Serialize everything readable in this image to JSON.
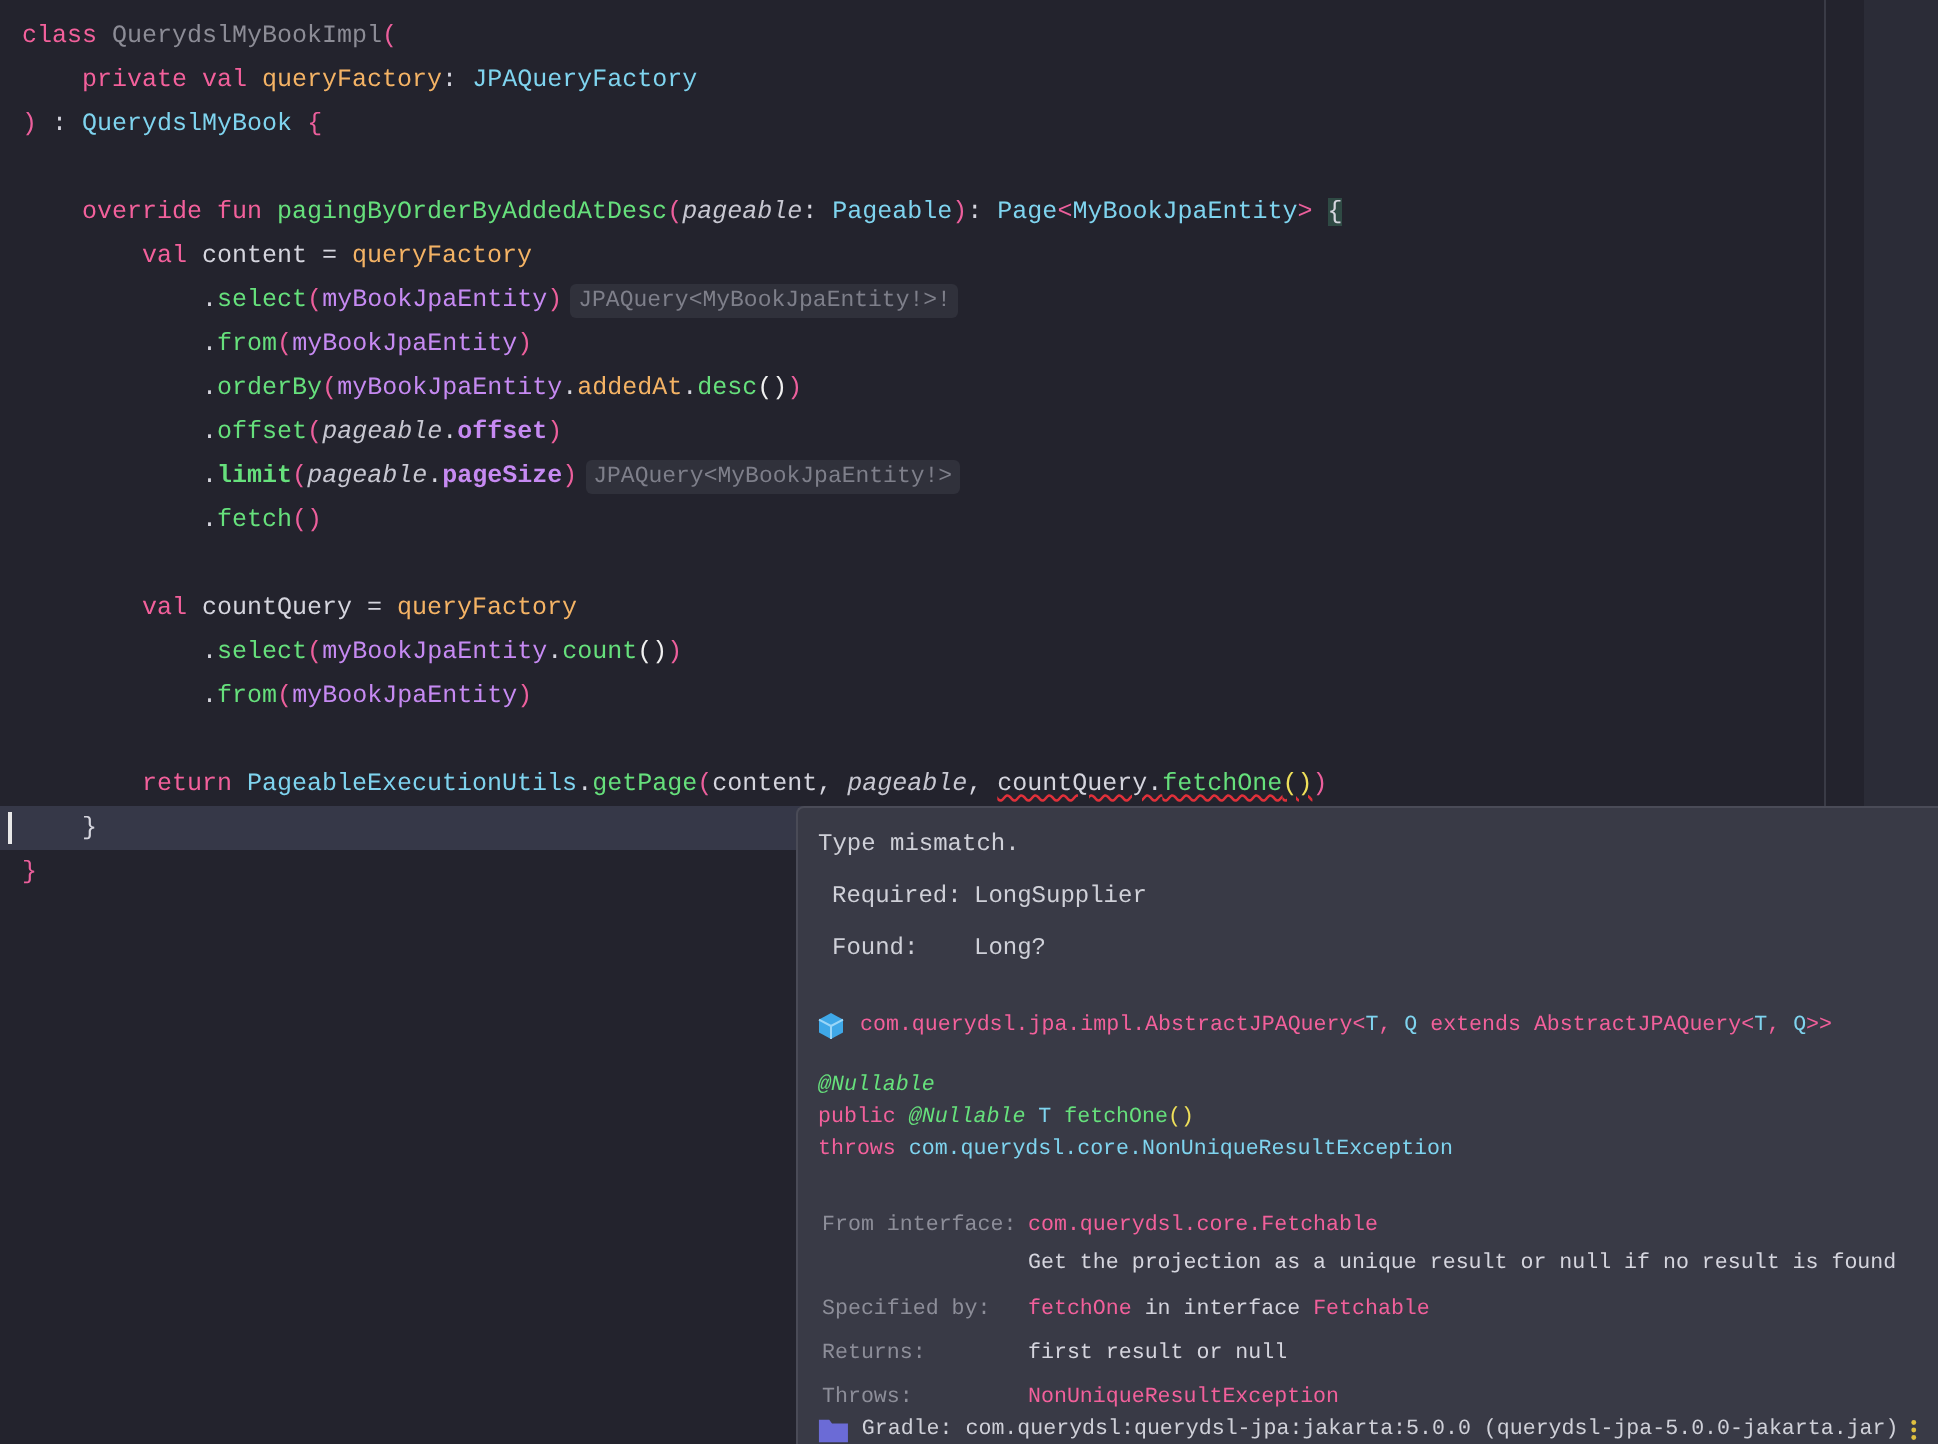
{
  "editor": {
    "lines": [
      {
        "current": false,
        "tokens": [
          {
            "kind": "kw",
            "text": "class "
          },
          {
            "kind": "unused",
            "text": "QuerydslMyBookImpl"
          },
          {
            "kind": "paren",
            "text": "("
          }
        ]
      },
      {
        "current": false,
        "tokens": [
          {
            "kind": "kw",
            "text": "    private val "
          },
          {
            "kind": "prop",
            "text": "queryFactory"
          },
          {
            "kind": "plain",
            "text": ": "
          },
          {
            "kind": "type",
            "text": "JPAQueryFactory"
          }
        ]
      },
      {
        "current": false,
        "tokens": [
          {
            "kind": "paren",
            "text": ")"
          },
          {
            "kind": "plain",
            "text": " : "
          },
          {
            "kind": "type",
            "text": "QuerydslMyBook"
          },
          {
            "kind": "paren",
            "text": " {"
          }
        ]
      },
      {
        "current": false
      },
      {
        "current": false,
        "tokens": [
          {
            "kind": "kw",
            "text": "    override fun "
          },
          {
            "kind": "func",
            "text": "pagingByOrderByAddedAtDesc"
          },
          {
            "kind": "paren",
            "text": "("
          },
          {
            "kind": "param",
            "text": "pageable"
          },
          {
            "kind": "plain",
            "text": ": "
          },
          {
            "kind": "type",
            "text": "Pageable"
          },
          {
            "kind": "paren",
            "text": ")"
          },
          {
            "kind": "plain",
            "text": ": "
          },
          {
            "kind": "type",
            "text": "Page"
          },
          {
            "kind": "paren",
            "text": "<"
          },
          {
            "kind": "type",
            "text": "MyBookJpaEntity"
          },
          {
            "kind": "paren",
            "text": "> "
          },
          {
            "kind": "brace_match",
            "text": "{"
          }
        ]
      },
      {
        "current": false,
        "tokens": [
          {
            "kind": "kw",
            "text": "        val "
          },
          {
            "kind": "plain",
            "text": "content = "
          },
          {
            "kind": "prop",
            "text": "queryFactory"
          }
        ]
      },
      {
        "current": false,
        "hint": "JPAQuery<MyBookJpaEntity!>!",
        "tokens": [
          {
            "kind": "plain",
            "text": "            ."
          },
          {
            "kind": "func",
            "text": "select"
          },
          {
            "kind": "paren",
            "text": "("
          },
          {
            "kind": "member",
            "text": "myBookJpaEntity"
          },
          {
            "kind": "paren",
            "text": ")"
          }
        ]
      },
      {
        "current": false,
        "tokens": [
          {
            "kind": "plain",
            "text": "            ."
          },
          {
            "kind": "func",
            "text": "from"
          },
          {
            "kind": "paren",
            "text": "("
          },
          {
            "kind": "member",
            "text": "myBookJpaEntity"
          },
          {
            "kind": "paren",
            "text": ")"
          }
        ]
      },
      {
        "current": false,
        "tokens": [
          {
            "kind": "plain",
            "text": "            ."
          },
          {
            "kind": "func",
            "text": "orderBy"
          },
          {
            "kind": "paren",
            "text": "("
          },
          {
            "kind": "member",
            "text": "myBookJpaEntity"
          },
          {
            "kind": "plain",
            "text": "."
          },
          {
            "kind": "prop",
            "text": "addedAt"
          },
          {
            "kind": "plain",
            "text": "."
          },
          {
            "kind": "func",
            "text": "desc"
          },
          {
            "kind": "inner_paren",
            "text": "()"
          },
          {
            "kind": "paren",
            "text": ")"
          }
        ]
      },
      {
        "current": false,
        "tokens": [
          {
            "kind": "plain",
            "text": "            ."
          },
          {
            "kind": "func",
            "text": "offset"
          },
          {
            "kind": "paren",
            "text": "("
          },
          {
            "kind": "param",
            "text": "pageable"
          },
          {
            "kind": "plain",
            "text": "."
          },
          {
            "kind": "member_bold",
            "text": "offset"
          },
          {
            "kind": "paren",
            "text": ")"
          }
        ]
      },
      {
        "current": false,
        "hint": "JPAQuery<MyBookJpaEntity!>",
        "tokens": [
          {
            "kind": "plain",
            "text": "            ."
          },
          {
            "kind": "func_bold",
            "text": "limit"
          },
          {
            "kind": "paren",
            "text": "("
          },
          {
            "kind": "param",
            "text": "pageable"
          },
          {
            "kind": "plain",
            "text": "."
          },
          {
            "kind": "member_bold",
            "text": "pageSize"
          },
          {
            "kind": "paren",
            "text": ")"
          }
        ]
      },
      {
        "current": false,
        "tokens": [
          {
            "kind": "plain",
            "text": "            ."
          },
          {
            "kind": "func",
            "text": "fetch"
          },
          {
            "kind": "paren",
            "text": "()"
          }
        ]
      },
      {
        "current": false
      },
      {
        "current": false,
        "tokens": [
          {
            "kind": "kw",
            "text": "        val "
          },
          {
            "kind": "plain",
            "text": "countQuery = "
          },
          {
            "kind": "prop",
            "text": "queryFactory"
          }
        ]
      },
      {
        "current": false,
        "tokens": [
          {
            "kind": "plain",
            "text": "            ."
          },
          {
            "kind": "func",
            "text": "select"
          },
          {
            "kind": "paren",
            "text": "("
          },
          {
            "kind": "member",
            "text": "myBookJpaEntity"
          },
          {
            "kind": "plain",
            "text": "."
          },
          {
            "kind": "func",
            "text": "count"
          },
          {
            "kind": "inner_paren",
            "text": "()"
          },
          {
            "kind": "paren",
            "text": ")"
          }
        ]
      },
      {
        "current": false,
        "tokens": [
          {
            "kind": "plain",
            "text": "            ."
          },
          {
            "kind": "func",
            "text": "from"
          },
          {
            "kind": "paren",
            "text": "("
          },
          {
            "kind": "member",
            "text": "myBookJpaEntity"
          },
          {
            "kind": "paren",
            "text": ")"
          }
        ]
      },
      {
        "current": false
      },
      {
        "current": false,
        "tokens": [
          {
            "kind": "kw",
            "text": "        return "
          },
          {
            "kind": "type",
            "text": "PageableExecutionUtils"
          },
          {
            "kind": "plain",
            "text": "."
          },
          {
            "kind": "func",
            "text": "getPage"
          },
          {
            "kind": "paren",
            "text": "("
          },
          {
            "kind": "plain",
            "text": "content, "
          },
          {
            "kind": "param",
            "text": "pageable"
          },
          {
            "kind": "plain",
            "text": ", "
          },
          {
            "kind": "plain_err",
            "text": "countQuery."
          },
          {
            "kind": "func_err",
            "text": "fetchOne"
          },
          {
            "kind": "yellow_err",
            "text": "()"
          },
          {
            "kind": "paren",
            "text": ")"
          }
        ]
      },
      {
        "current": true,
        "tokens": [
          {
            "kind": "plain",
            "text": "    }"
          }
        ]
      },
      {
        "current": false,
        "tokens": [
          {
            "kind": "paren",
            "text": "}"
          }
        ]
      }
    ]
  },
  "tooltip": {
    "title": "Type mismatch.",
    "rows": [
      {
        "label": "Required:",
        "value": "LongSupplier"
      },
      {
        "label": "Found:",
        "value": "Long?"
      }
    ],
    "header": [
      {
        "kind": "kw",
        "text": "com.querydsl.jpa.impl.AbstractJPAQuery"
      },
      {
        "kind": "kw",
        "text": "<"
      },
      {
        "kind": "type",
        "text": "T"
      },
      {
        "kind": "kw",
        "text": ", "
      },
      {
        "kind": "type",
        "text": "Q"
      },
      {
        "kind": "kw",
        "text": " extends AbstractJPAQuery"
      },
      {
        "kind": "kw",
        "text": "<"
      },
      {
        "kind": "type",
        "text": "T"
      },
      {
        "kind": "kw",
        "text": ", "
      },
      {
        "kind": "type",
        "text": "Q"
      },
      {
        "kind": "kw",
        "text": ">>"
      }
    ],
    "declaration": [
      [
        {
          "kind": "annotation",
          "text": "@Nullable"
        }
      ],
      [
        {
          "kind": "kw",
          "text": "public "
        },
        {
          "kind": "annotation",
          "text": "@Nullable"
        },
        {
          "kind": "type",
          "text": " T "
        },
        {
          "kind": "func",
          "text": "fetchOne"
        },
        {
          "kind": "yellow",
          "text": "()"
        }
      ],
      [
        {
          "kind": "kw",
          "text": "throws "
        },
        {
          "kind": "type",
          "text": "com.querydsl.core.NonUniqueResultException"
        }
      ]
    ],
    "details": [
      {
        "label": "From interface:",
        "lines": [
          [
            {
              "kind": "link",
              "text": "com.querydsl.core.Fetchable"
            }
          ],
          [
            {
              "kind": "plain",
              "text": "Get the projection as a unique result or null if no result is found"
            }
          ]
        ]
      },
      {
        "label": "Specified by:",
        "lines": [
          [
            {
              "kind": "link",
              "text": "fetchOne"
            },
            {
              "kind": "plain",
              "text": " in interface "
            },
            {
              "kind": "link",
              "text": "Fetchable"
            }
          ]
        ]
      },
      {
        "label": "Returns:",
        "lines": [
          [
            {
              "kind": "plain",
              "text": "first result or null"
            }
          ]
        ]
      },
      {
        "label": "Throws:",
        "lines": [
          [
            {
              "kind": "link",
              "text": "NonUniqueResultException"
            }
          ]
        ]
      }
    ],
    "footer": "Gradle: com.querydsl:querydsl-jpa:jakarta:5.0.0 (querydsl-jpa-5.0.0-jakarta.jar)"
  }
}
